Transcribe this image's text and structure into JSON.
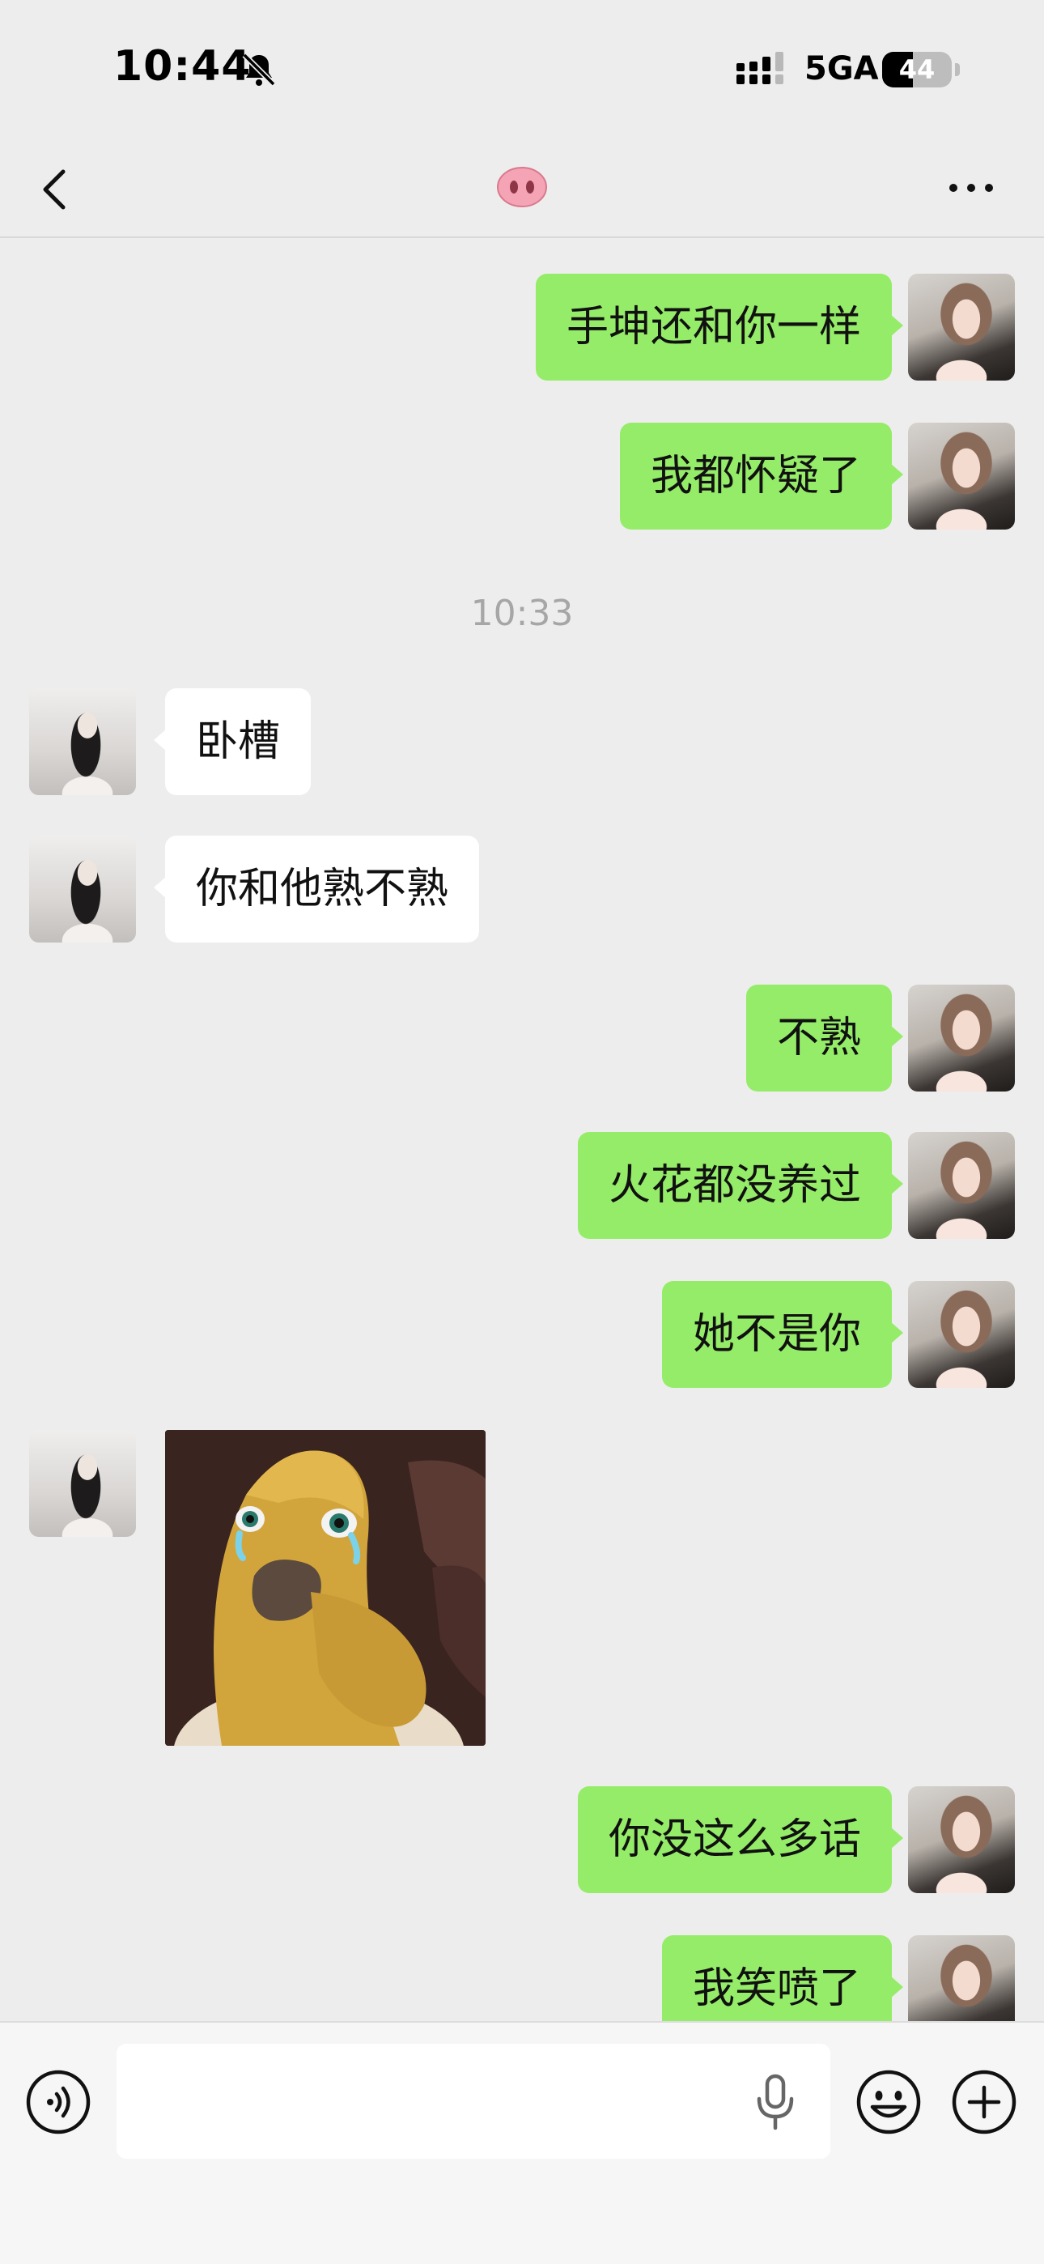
{
  "status_bar": {
    "time": "10:44",
    "network": "5GA",
    "battery": "44",
    "battery_level": 0.44,
    "icons": [
      "bell-slash-icon",
      "signal-icon"
    ]
  },
  "nav": {
    "title_icon": "pig-nose-icon",
    "back_icon": "chevron-left-icon",
    "more_icon": "ellipsis-icon"
  },
  "messages": [
    {
      "side": "out",
      "text": "手坤还和你一样"
    },
    {
      "side": "out",
      "text": "我都怀疑了"
    },
    {
      "type": "time",
      "text": "10:33"
    },
    {
      "side": "in",
      "text": "卧槽"
    },
    {
      "side": "in",
      "text": "你和他熟不熟"
    },
    {
      "side": "out",
      "text": "不熟"
    },
    {
      "side": "out",
      "text": "火花都没养过"
    },
    {
      "side": "out",
      "text": "她不是你"
    },
    {
      "side": "in",
      "type": "sticker",
      "sticker": "crying-yellow-creature-covering-mouth"
    },
    {
      "side": "out",
      "text": "你没这么多话"
    },
    {
      "side": "out",
      "text": "我笑喷了"
    }
  ],
  "input_bar": {
    "value": "",
    "icons": [
      "voice-icon",
      "mic-icon",
      "emoji-icon",
      "plus-icon"
    ]
  },
  "colors": {
    "background": "#ededed",
    "outgoing_bubble": "#95ec69",
    "incoming_bubble": "#ffffff",
    "timestamp": "#a6a6a6"
  }
}
